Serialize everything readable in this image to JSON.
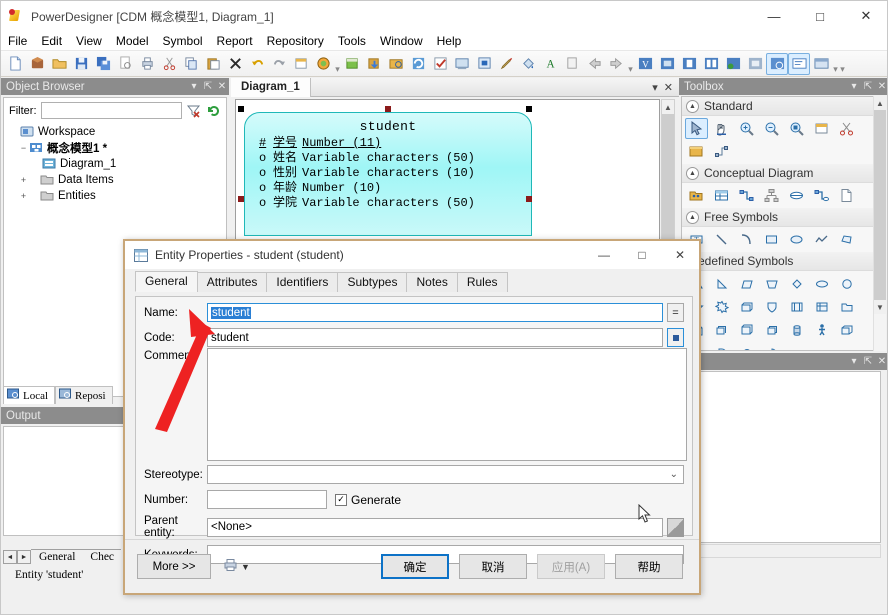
{
  "window": {
    "title": "PowerDesigner [CDM 概念模型1, Diagram_1]",
    "minimize": "—",
    "maximize": "□",
    "close": "✕",
    "app_icon": "powerdesigner-icon"
  },
  "menubar": {
    "items": [
      "File",
      "Edit",
      "View",
      "Model",
      "Symbol",
      "Report",
      "Repository",
      "Tools",
      "Window",
      "Help"
    ]
  },
  "toolbar": {
    "groups": [
      {
        "icons": [
          "new-document-icon",
          "new-model-icon",
          "open-folder-icon",
          "save-icon",
          "save-all-icon",
          "print-preview-icon",
          "print-icon",
          "cut-icon",
          "copy-icon",
          "paste-icon",
          "delete-icon",
          "undo-icon",
          "redo-icon",
          "properties-icon",
          "find-icon"
        ]
      },
      {
        "icons": [
          "new-diagram-icon",
          "import-icon",
          "package-icon",
          "refresh-icon",
          "check-model-icon",
          "display-preferences-icon"
        ]
      },
      {
        "icons": [
          "format-icon",
          "font-icon",
          "pen-icon",
          "fill-icon",
          "text-color-icon",
          "clipboard-icon",
          "arrow-left-icon",
          "arrow-right-icon"
        ]
      },
      {
        "icons": [
          "view-model-icon",
          "view-diagram-icon",
          "align-left-icon",
          "align-center-icon",
          "generate-icon",
          "view-grid-icon",
          "browser-toggle-icon",
          "output-toggle-icon",
          "result-list-icon"
        ]
      }
    ]
  },
  "object_browser": {
    "title": "Object Browser",
    "header_buttons": [
      "chevron-down-icon",
      "pin-icon",
      "close-icon"
    ],
    "filter_label": "Filter:",
    "filter_value": "",
    "filter_icons": [
      "clear-filter-icon",
      "refresh-icon"
    ],
    "tree": [
      {
        "label": "Workspace",
        "icon": "workspace-icon",
        "level": 0,
        "expander": "",
        "bold": false
      },
      {
        "label": "概念模型1 *",
        "icon": "model-icon",
        "level": 1,
        "expander": "−",
        "bold": true
      },
      {
        "label": "Diagram_1",
        "icon": "diagram-icon",
        "level": 2,
        "expander": "",
        "bold": false
      },
      {
        "label": "Data Items",
        "icon": "folder-icon",
        "level": 2,
        "expander": "+",
        "bold": false
      },
      {
        "label": "Entities",
        "icon": "folder-icon",
        "level": 2,
        "expander": "+",
        "bold": false
      }
    ],
    "tabs": [
      {
        "label": "Local",
        "icon": "local-icon",
        "active": true
      },
      {
        "label": "Reposi",
        "icon": "repository-icon",
        "active": false
      }
    ]
  },
  "output_panel": {
    "title": "Output",
    "header_buttons": [
      "chevron-down-icon",
      "pin-icon",
      "close-icon"
    ],
    "content": "",
    "tabs": [
      "General",
      "Chec"
    ],
    "nav_prev": "◄",
    "nav_next": "►"
  },
  "statusbar": {
    "text": "Entity 'student'"
  },
  "diagram": {
    "tab_label": "Diagram_1",
    "tab_buttons": [
      "chevron-down-icon",
      "close-icon"
    ],
    "entity": {
      "name": "student",
      "attributes": [
        {
          "marker": "#",
          "name": "学号",
          "type": "Number (11)",
          "primary": true
        },
        {
          "marker": "o",
          "name": "姓名",
          "type": "Variable characters (50)",
          "primary": false
        },
        {
          "marker": "o",
          "name": "性别",
          "type": "Variable characters (10)",
          "primary": false
        },
        {
          "marker": "o",
          "name": "年龄",
          "type": "Number (10)",
          "primary": false
        },
        {
          "marker": "o",
          "name": "学院",
          "type": "Variable characters (50)",
          "primary": false
        }
      ],
      "fill_color": "#9ff6f6",
      "border_color": "#1fb8b8",
      "selected": true
    }
  },
  "toolbox": {
    "title": "Toolbox",
    "header_buttons": [
      "chevron-down-icon",
      "pin-icon",
      "close-icon"
    ],
    "groups": [
      {
        "name": "Standard",
        "collapse_icon": "chevron-up-icon",
        "tools": [
          {
            "name": "pointer-icon",
            "selected": true
          },
          {
            "name": "grabber-hand-icon",
            "selected": false
          },
          {
            "name": "zoom-in-icon",
            "selected": false
          },
          {
            "name": "zoom-out-icon",
            "selected": false
          },
          {
            "name": "zoom-area-icon",
            "selected": false
          },
          {
            "name": "properties-icon",
            "selected": false
          },
          {
            "name": "scissors-icon",
            "selected": false
          },
          {
            "name": "note-icon",
            "selected": false
          },
          {
            "name": "link-icon",
            "selected": false
          }
        ]
      },
      {
        "name": "Conceptual Diagram",
        "collapse_icon": "chevron-up-icon",
        "tools": [
          {
            "name": "package-icon",
            "selected": false
          },
          {
            "name": "entity-icon",
            "selected": false
          },
          {
            "name": "relationship-icon",
            "selected": false
          },
          {
            "name": "inheritance-icon",
            "selected": false
          },
          {
            "name": "association-icon",
            "selected": false
          },
          {
            "name": "association-link-icon",
            "selected": false
          },
          {
            "name": "file-icon",
            "selected": false
          }
        ]
      },
      {
        "name": "Free Symbols",
        "collapse_icon": "chevron-up-icon",
        "tools": [
          {
            "name": "text-icon",
            "selected": false
          },
          {
            "name": "line-icon",
            "selected": false
          },
          {
            "name": "arc-icon",
            "selected": false
          },
          {
            "name": "rectangle-icon",
            "selected": false
          },
          {
            "name": "ellipse-icon",
            "selected": false
          },
          {
            "name": "polyline-icon",
            "selected": false
          },
          {
            "name": "polygon-icon",
            "selected": false
          }
        ]
      },
      {
        "name": "Predefined Symbols",
        "collapse_icon": "",
        "tools": [
          {
            "name": "triangle-icon",
            "selected": false
          },
          {
            "name": "right-triangle-icon",
            "selected": false
          },
          {
            "name": "parallelogram-icon",
            "selected": false
          },
          {
            "name": "trapezoid-icon",
            "selected": false
          },
          {
            "name": "diamond-icon",
            "selected": false
          },
          {
            "name": "oval-icon",
            "selected": false
          },
          {
            "name": "circle-icon",
            "selected": false
          },
          {
            "name": "star5-icon",
            "selected": false
          },
          {
            "name": "star8-icon",
            "selected": false
          },
          {
            "name": "cube-face-icon",
            "selected": false
          },
          {
            "name": "shield-icon",
            "selected": false
          },
          {
            "name": "window-icon",
            "selected": false
          },
          {
            "name": "table-icon",
            "selected": false
          },
          {
            "name": "folder-icon",
            "selected": false
          },
          {
            "name": "page-icon",
            "selected": false
          },
          {
            "name": "stack-icon",
            "selected": false
          },
          {
            "name": "cube-icon",
            "selected": false
          },
          {
            "name": "layers-icon",
            "selected": false
          },
          {
            "name": "cylinder-icon",
            "selected": false
          },
          {
            "name": "actor-icon",
            "selected": false
          },
          {
            "name": "box3d-icon",
            "selected": false
          },
          {
            "name": "chevron-shape-icon",
            "selected": false
          },
          {
            "name": "arc-shape-icon",
            "selected": false
          },
          {
            "name": "half-circle-icon",
            "selected": false
          },
          {
            "name": "pie-icon",
            "selected": false
          }
        ]
      }
    ]
  },
  "dialog": {
    "title": "Entity Properties - student (student)",
    "icon": "entity-properties-icon",
    "minimize": "—",
    "maximize": "□",
    "close": "✕",
    "tabs": [
      {
        "label": "General",
        "active": true
      },
      {
        "label": "Attributes",
        "active": false
      },
      {
        "label": "Identifiers",
        "active": false
      },
      {
        "label": "Subtypes",
        "active": false
      },
      {
        "label": "Notes",
        "active": false
      },
      {
        "label": "Rules",
        "active": false
      }
    ],
    "fields": {
      "name_label": "Name:",
      "name_value": "student",
      "name_selected": true,
      "code_label": "Code:",
      "code_value": "student",
      "comment_label": "Comment:",
      "comment_value": "",
      "stereotype_label": "Stereotype:",
      "stereotype_value": "",
      "number_label": "Number:",
      "number_value": "",
      "generate_label": "Generate",
      "generate_checked": true,
      "parent_entity_label": "Parent entity:",
      "parent_entity_value": "<None>",
      "keywords_label": "Keywords:",
      "keywords_value": ""
    },
    "buttons": {
      "more": "More >>",
      "print_icon": "print-icon",
      "dropdown_icon": "chevron-down-icon",
      "ok": "确定",
      "cancel": "取消",
      "apply": "应用(A)",
      "apply_disabled": true,
      "help": "帮助"
    }
  },
  "annotation": {
    "arrow_color": "#ee2222",
    "arrow_name": "red-pointer-arrow"
  },
  "colors": {
    "accent_blue": "#2a7fd4",
    "entity_cyan": "#9ff6f6",
    "dialog_border": "#c8a678",
    "panel_header": "#8c8c8c"
  }
}
